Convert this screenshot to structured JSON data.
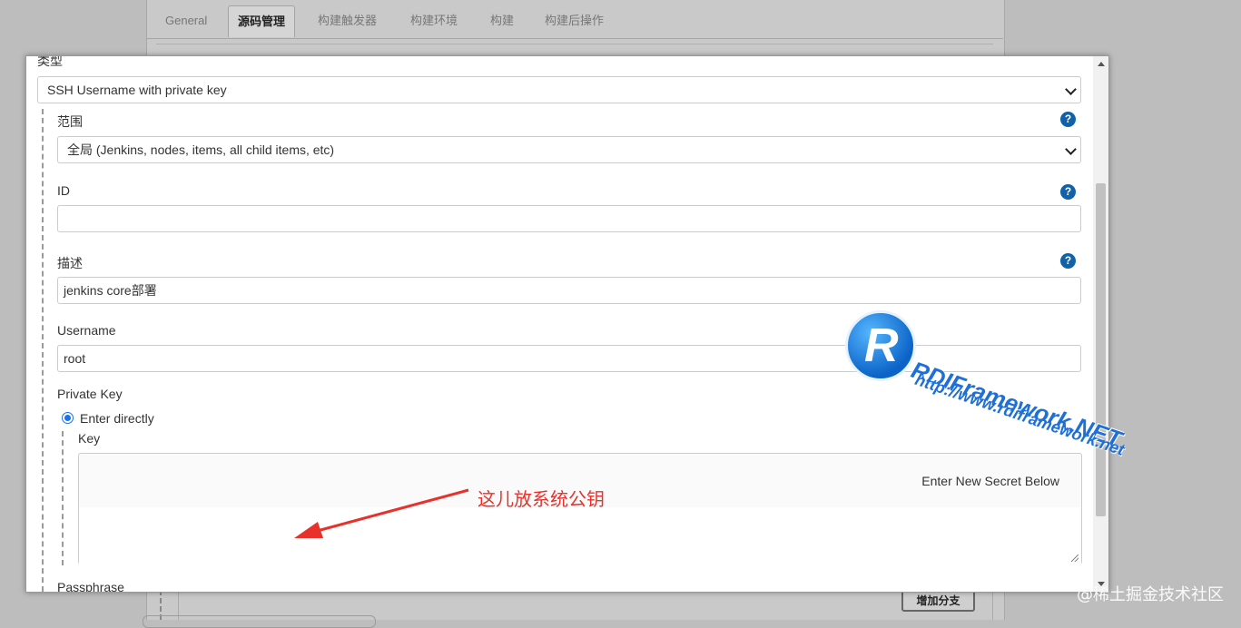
{
  "background_page": {
    "tabs": [
      "General",
      "源码管理",
      "构建触发器",
      "构建环境",
      "构建",
      "构建后操作"
    ],
    "active_tab": "源码管理",
    "add_branch_button": "增加分支"
  },
  "dialog": {
    "kind_label": "类型",
    "kind_value": "SSH Username with private key",
    "scope_label": "范围",
    "scope_value": "全局 (Jenkins, nodes, items, all child items, etc)",
    "id_label": "ID",
    "id_value": "",
    "description_label": "描述",
    "description_value": "jenkins core部署",
    "username_label": "Username",
    "username_value": "root",
    "private_key_label": "Private Key",
    "enter_directly_label": "Enter directly",
    "key_label": "Key",
    "key_secret_hint": "Enter New Secret Below",
    "passphrase_label": "Passphrase"
  },
  "annotation": {
    "text": "这儿放系统公钥",
    "color": "#e8312a"
  },
  "watermark": {
    "logo_letter": "R",
    "line1": "RDIFramework.NET",
    "line2": "http://www.rdiframework.net",
    "footer": "@稀土掘金技术社区"
  },
  "colors": {
    "help_icon": "#0f62a7",
    "radio": "#1a73e8"
  }
}
